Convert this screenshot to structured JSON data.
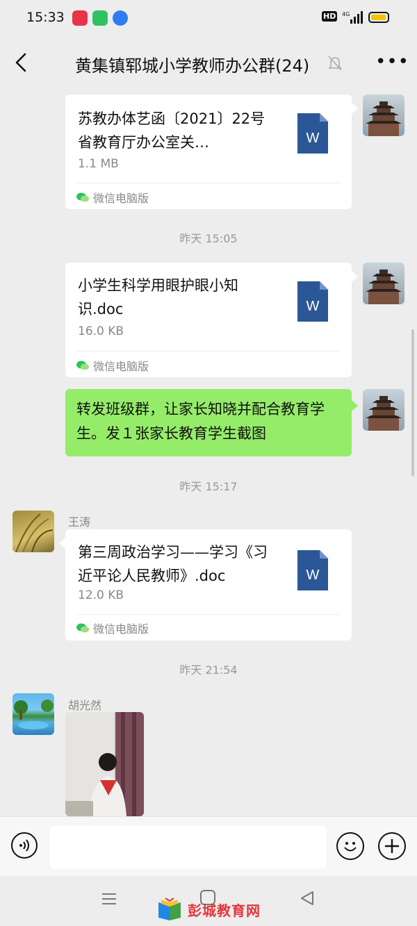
{
  "status_bar": {
    "time": "15:33",
    "network": "4G",
    "hd": "HD"
  },
  "header": {
    "title": "黄集镇郓城小学教师办公群(24)",
    "back_icon": "chevron-left-icon",
    "mute_icon": "bell-off-icon",
    "more_label": "•••"
  },
  "messages": [
    {
      "type": "file",
      "side": "right",
      "name": "苏教办体艺函〔2021〕22号省教育厅办公室关…",
      "size": "1.1 MB",
      "source": "微信电脑版"
    },
    {
      "type": "time",
      "text": "昨天 15:05"
    },
    {
      "type": "file",
      "side": "right",
      "name": "小学生科学用眼护眼小知识.doc",
      "size": "16.0 KB",
      "source": "微信电脑版"
    },
    {
      "type": "text",
      "side": "right",
      "text": "转发班级群，让家长知晓并配合教育学生。发１张家长教育学生截图"
    },
    {
      "type": "time",
      "text": "昨天 15:17"
    },
    {
      "type": "file",
      "side": "left",
      "sender": "王涛",
      "name": "第三周政治学习——学习《习近平论人民教师》.doc",
      "size": "12.0 KB",
      "source": "微信电脑版"
    },
    {
      "type": "time",
      "text": "昨天 21:54"
    },
    {
      "type": "image",
      "side": "left",
      "sender": "胡光然"
    }
  ],
  "word_icon_letter": "W",
  "input_bar": {
    "placeholder": "",
    "voice_icon": "voice-icon",
    "emoji_icon": "emoji-icon",
    "plus_icon": "plus-icon"
  },
  "watermark": "彭城教育网",
  "colors": {
    "background": "#ededed",
    "bubble_green": "#95ec69",
    "word_blue": "#2b5797",
    "watermark_red": "#e4353b"
  }
}
